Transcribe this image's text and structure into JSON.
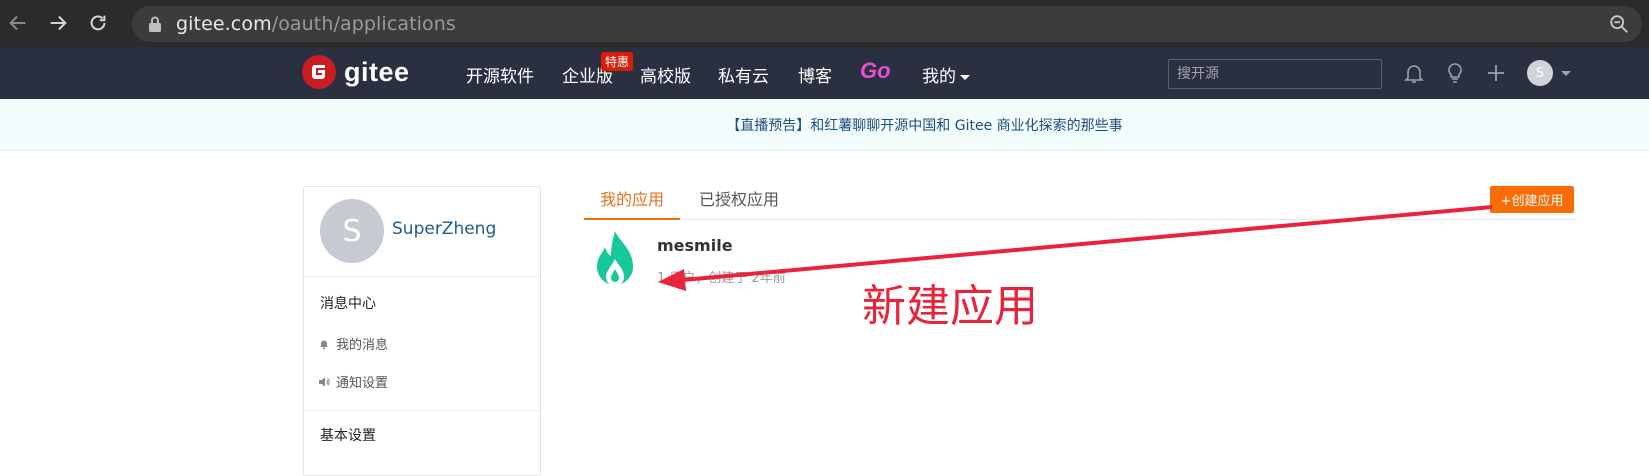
{
  "browser": {
    "url_host": "gitee.com",
    "url_path": "/oauth/applications"
  },
  "header": {
    "logo_text": "gitee",
    "nav": [
      "开源软件",
      "企业版",
      "高校版",
      "私有云",
      "博客"
    ],
    "special_badge": "特惠",
    "go_label": "Go",
    "mine_label": "我的",
    "search_placeholder": "搜开源",
    "avatar_initial": "S",
    "brand_color": "#c71d23",
    "header_bg": "#2b3040"
  },
  "banner": {
    "text": "【直播预告】和红薯聊聊开源中国和 Gitee 商业化探索的那些事"
  },
  "sidebar": {
    "avatar_initial": "S",
    "username": "SuperZheng",
    "message_center": "消息中心",
    "my_messages": "我的消息",
    "notify_settings": "通知设置",
    "basic_settings": "基本设置"
  },
  "main": {
    "tabs": [
      "我的应用",
      "已授权应用"
    ],
    "create_button": "+创建应用",
    "accent_color": "#fb6c06",
    "app": {
      "name": "mesmile",
      "meta": "1 用户，创建于 2年前"
    }
  },
  "annotation": {
    "text": "新建应用",
    "color": "#e8233a"
  }
}
